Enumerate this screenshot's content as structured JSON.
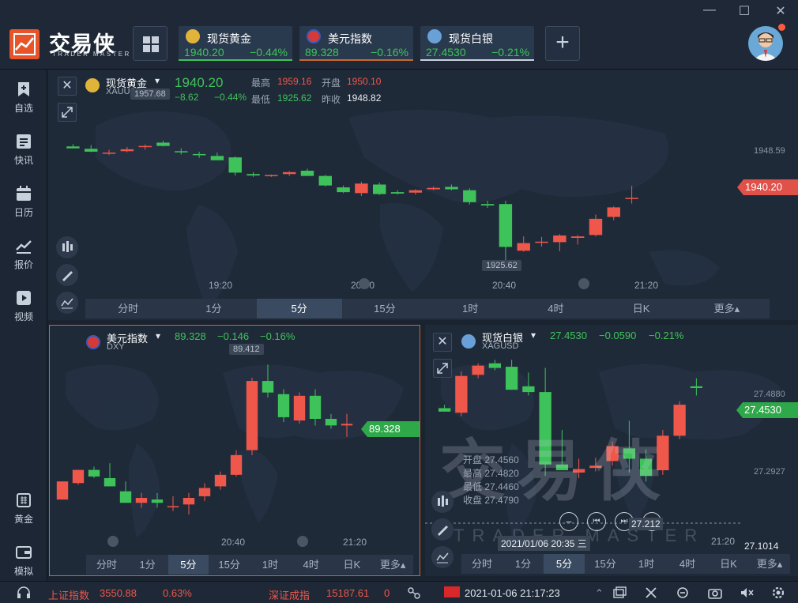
{
  "app": {
    "brand": "交易侠",
    "brand_sub": "TRADER MASTER"
  },
  "window": {
    "minimize": "—",
    "maximize": "☐",
    "close": "✕"
  },
  "tabs": [
    {
      "name": "现货黄金",
      "price": "1940.20",
      "change": "−0.44%",
      "icon": "gold-icon",
      "color": "#3ec35a"
    },
    {
      "name": "美元指数",
      "price": "89.328",
      "change": "−0.16%",
      "icon": "us-flag-icon",
      "color": "#c86a30"
    },
    {
      "name": "现货白银",
      "price": "27.4530",
      "change": "−0.21%",
      "icon": "silver-icon",
      "color": "#3a4a60"
    }
  ],
  "add_tab": "+",
  "sidebar": {
    "items": [
      {
        "label": "自选",
        "icon": "bookmark-add-icon"
      },
      {
        "label": "快讯",
        "icon": "list-icon"
      },
      {
        "label": "日历",
        "icon": "calendar-icon"
      },
      {
        "label": "报价",
        "icon": "trend-icon"
      },
      {
        "label": "视频",
        "icon": "play-icon"
      },
      {
        "label": "黄金",
        "icon": "gold-bars-icon"
      },
      {
        "label": "模拟",
        "icon": "wallet-icon"
      }
    ]
  },
  "gold": {
    "name": "现货黄金",
    "code": "XAUUSD",
    "price": "1940.20",
    "change": "−8.62",
    "change_pct": "−0.44%",
    "high_label": "最高",
    "high": "1959.16",
    "open_label": "开盘",
    "open": "1950.10",
    "low_label": "最低",
    "low": "1925.62",
    "prev_label": "昨收",
    "prev": "1948.82",
    "chart_hi": "1957.68",
    "chart_lo": "1925.62",
    "axis_label": "1948.59",
    "tag": "1940.20",
    "times": [
      "19:20",
      "20:00",
      "20:40",
      "21:20"
    ]
  },
  "dxy": {
    "name": "美元指数",
    "code": "DXY",
    "price": "89.328",
    "change": "−0.146",
    "change_pct": "−0.16%",
    "chart_hi": "89.412",
    "tag": "89.328",
    "times": [
      "20:40",
      "21:20"
    ]
  },
  "silver": {
    "name": "现货白银",
    "code": "XAGUSD",
    "price": "27.4530",
    "change": "−0.0590",
    "change_pct": "−0.21%",
    "axis_top": "27.4880",
    "axis_mid": "27.2927",
    "axis_bottom": "27.1014",
    "tag": "27.4530",
    "ohlc": [
      {
        "label": "开盘",
        "value": "27.4560"
      },
      {
        "label": "最高",
        "value": "27.4820"
      },
      {
        "label": "最低",
        "value": "27.4460"
      },
      {
        "label": "收盘",
        "value": "27.4790"
      }
    ],
    "cursor_date": "2021/01/06 20:35 三",
    "cursor_price": "27.212",
    "time_right": "21:20",
    "watermark": "交易侠",
    "watermark_sub": "TRADER MASTER"
  },
  "timeframes_full": [
    "分时",
    "1分",
    "5分",
    "15分",
    "1时",
    "4时",
    "日K",
    "更多▴"
  ],
  "timeframes_active": "5分",
  "status": {
    "sh_name": "上证指数",
    "sh_value": "3550.88",
    "sh_pct": "0.63%",
    "sz_name": "深证成指",
    "sz_value": "15187.61",
    "sz_pct": "0",
    "datetime": "2021-01-06 21:17:23"
  },
  "colors": {
    "up": "#f0574b",
    "down": "#3ec35a",
    "bg": "#1a2330",
    "panel": "#1f2a38",
    "brand": "#e8542a"
  },
  "chart_data": [
    {
      "type": "candlestick",
      "title": "现货黄金",
      "x": [
        "19:20",
        "20:00",
        "20:40",
        "21:20"
      ],
      "series": [
        {
          "values": [
            [
              1951.0,
              1951.5,
              1950.6,
              1950.6
            ],
            [
              1950.5,
              1951.3,
              1949.8,
              1949.9
            ],
            [
              1949.7,
              1950.3,
              1949.2,
              1949.7
            ],
            [
              1950.0,
              1950.9,
              1949.8,
              1950.4
            ],
            [
              1950.9,
              1951.4,
              1950.3,
              1951.1
            ],
            [
              1951.8,
              1952.2,
              1951.0,
              1951.1
            ],
            [
              1950.0,
              1950.6,
              1949.3,
              1949.8
            ],
            [
              1949.4,
              1949.9,
              1948.6,
              1949.3
            ],
            [
              1949.0,
              1949.7,
              1948.2,
              1948.1
            ],
            [
              1948.7,
              1948.9,
              1944.9,
              1945.5
            ],
            [
              1945.2,
              1945.6,
              1944.6,
              1944.9
            ],
            [
              1944.9,
              1945.1,
              1944.6,
              1945.0
            ],
            [
              1945.2,
              1945.8,
              1944.8,
              1945.6
            ],
            [
              1945.9,
              1946.3,
              1944.9,
              1944.8
            ],
            [
              1944.8,
              1945.0,
              1942.6,
              1942.8
            ],
            [
              1942.4,
              1942.8,
              1941.2,
              1941.4
            ],
            [
              1941.2,
              1943.6,
              1940.6,
              1943.2
            ],
            [
              1943.0,
              1943.4,
              1940.8,
              1941.0
            ],
            [
              1941.4,
              1941.8,
              1940.9,
              1941.1
            ],
            [
              1941.3,
              1942.0,
              1940.9,
              1941.8
            ],
            [
              1942.0,
              1942.6,
              1941.8,
              1942.3
            ],
            [
              1942.5,
              1943.0,
              1941.8,
              1942.0
            ],
            [
              1941.8,
              1942.2,
              1938.8,
              1939.3
            ],
            [
              1938.9,
              1939.6,
              1938.1,
              1938.6
            ],
            [
              1938.9,
              1939.6,
              1925.6,
              1929.9
            ],
            [
              1929.1,
              1932.1,
              1928.9,
              1930.7
            ],
            [
              1931.0,
              1932.0,
              1930.0,
              1931.0
            ],
            [
              1930.9,
              1932.6,
              1929.0,
              1932.3
            ],
            [
              1931.8,
              1932.4,
              1930.4,
              1932.1
            ],
            [
              1932.4,
              1936.7,
              1932.1,
              1935.8
            ],
            [
              1936.2,
              1938.4,
              1935.5,
              1938.2
            ],
            [
              1940.2,
              1942.7,
              1939.0,
              1940.2
            ]
          ]
        }
      ],
      "ylim": [
        1923,
        1962
      ]
    },
    {
      "type": "candlestick",
      "title": "美元指数",
      "x": [
        "20:40",
        "21:20"
      ],
      "series": [
        {
          "values": [
            [
              89.236,
              89.258,
              89.236,
              89.258
            ],
            [
              89.256,
              89.272,
              89.254,
              89.272
            ],
            [
              89.272,
              89.276,
              89.262,
              89.264
            ],
            [
              89.262,
              89.28,
              89.252,
              89.252
            ],
            [
              89.246,
              89.258,
              89.232,
              89.232
            ],
            [
              89.232,
              89.244,
              89.226,
              89.238
            ],
            [
              89.236,
              89.244,
              89.226,
              89.232
            ],
            [
              89.228,
              89.24,
              89.222,
              89.228
            ],
            [
              89.23,
              89.244,
              89.218,
              89.238
            ],
            [
              89.24,
              89.256,
              89.234,
              89.25
            ],
            [
              89.252,
              89.27,
              89.248,
              89.266
            ],
            [
              89.266,
              89.296,
              89.264,
              89.29
            ],
            [
              89.296,
              89.384,
              89.29,
              89.38
            ],
            [
              89.38,
              89.4,
              89.36,
              89.366
            ],
            [
              89.364,
              89.37,
              89.33,
              89.336
            ],
            [
              89.332,
              89.366,
              89.328,
              89.362
            ],
            [
              89.362,
              89.37,
              89.326,
              89.334
            ],
            [
              89.334,
              89.34,
              89.322,
              89.326
            ],
            [
              89.326,
              89.34,
              89.312,
              89.328
            ]
          ]
        }
      ],
      "ylim": [
        89.19,
        89.43
      ]
    },
    {
      "type": "candlestick",
      "title": "现货白银",
      "x": [
        "20:35",
        "21:20"
      ],
      "series": [
        {
          "values": [
            [
              27.418,
              27.424,
              27.412,
              27.412
            ],
            [
              27.41,
              27.482,
              27.404,
              27.474
            ],
            [
              27.476,
              27.496,
              27.47,
              27.492
            ],
            [
              27.496,
              27.502,
              27.484,
              27.488
            ],
            [
              27.49,
              27.502,
              27.45,
              27.45
            ],
            [
              27.456,
              27.48,
              27.44,
              27.446
            ],
            [
              27.446,
              27.488,
              27.3,
              27.32
            ],
            [
              27.32,
              27.38,
              27.31,
              27.31
            ],
            [
              27.306,
              27.33,
              27.296,
              27.312
            ],
            [
              27.314,
              27.332,
              27.308,
              27.318
            ],
            [
              27.326,
              27.36,
              27.318,
              27.352
            ],
            [
              27.348,
              27.396,
              27.306,
              27.33
            ],
            [
              27.33,
              27.346,
              27.29,
              27.3
            ],
            [
              27.31,
              27.38,
              27.302,
              27.37
            ],
            [
              27.37,
              27.43,
              27.364,
              27.424
            ],
            [
              27.456,
              27.47,
              27.44,
              27.453
            ]
          ]
        }
      ],
      "ylim": [
        27.2,
        27.53
      ]
    }
  ]
}
